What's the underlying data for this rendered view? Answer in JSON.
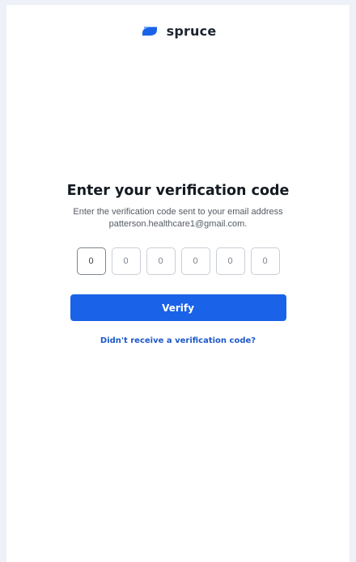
{
  "brand": {
    "name": "spruce",
    "icon": "spruce-logo-icon",
    "color": "#1a63e8"
  },
  "verification": {
    "title": "Enter your verification code",
    "subtitle": "Enter the verification code sent to your email address patterson.healthcare1@gmail.com.",
    "code_fields": [
      {
        "placeholder": "0",
        "focused": true
      },
      {
        "placeholder": "0",
        "focused": false
      },
      {
        "placeholder": "0",
        "focused": false
      },
      {
        "placeholder": "0",
        "focused": false
      },
      {
        "placeholder": "0",
        "focused": false
      },
      {
        "placeholder": "0",
        "focused": false
      }
    ],
    "verify_label": "Verify",
    "resend_label": "Didn't receive a verification code?"
  },
  "colors": {
    "primary": "#1a63e8",
    "link": "#1e58c9",
    "background": "#eef1f7"
  }
}
